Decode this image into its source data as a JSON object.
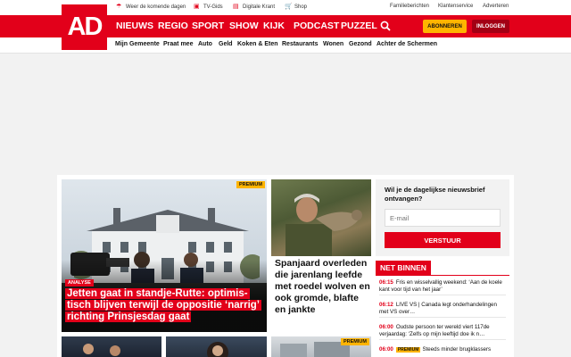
{
  "brand": {
    "logo_text": "AD",
    "accent": "#e2001a",
    "premium_color": "#ffb400"
  },
  "utility_left": [
    {
      "icon": "weather-icon",
      "label": "Weer de komende dagen"
    },
    {
      "icon": "tv-icon",
      "label": "TV-Gids"
    },
    {
      "icon": "newspaper-icon",
      "label": "Digitale Krant"
    },
    {
      "icon": "cart-icon",
      "label": "Shop"
    }
  ],
  "utility_right": [
    "Familieberichten",
    "Klantenservice",
    "Adverteren"
  ],
  "main_nav": [
    "NIEUWS",
    "REGIO",
    "SPORT",
    "SHOW",
    "KIJK",
    "PODCAST",
    "PUZZEL"
  ],
  "account": {
    "subscribe_label": "ABONNEREN",
    "login_label": "INLOGGEN"
  },
  "sub_nav": [
    "Mijn Gemeente",
    "Praat mee",
    "Auto",
    "Geld",
    "Koken & Eten",
    "Restaurants",
    "Wonen",
    "Gezond",
    "Achter de Schermen"
  ],
  "lead_article": {
    "badge": "PREMIUM",
    "tag": "ANALYSE",
    "headline": "Jetten gaat in standje-Rutte: optimis­tisch blijven terwijl de oppositie ‘narrig’ richting Prinsjesdag gaat"
  },
  "second_article": {
    "headline": "Spanjaard overleden die jarenlang leefde met roedel wolven en ook gromde, blafte en jankte"
  },
  "newsletter": {
    "question": "Wil je de dagelijkse nieuwsbrief ontvangen?",
    "email_placeholder": "E-mail",
    "submit_label": "VERSTUUR"
  },
  "net_binnen": {
    "title": "NET BINNEN",
    "items": [
      {
        "time": "06:15",
        "badge": "",
        "text": "Fris en wisselvallig weekend: ‘Aan de koele kant voor tijd van het jaar’"
      },
      {
        "time": "06:12",
        "badge": "",
        "text": "LIVE VS | Canada legt onderhandelingen met VS over…"
      },
      {
        "time": "06:00",
        "badge": "",
        "text": "Oudste persoon ter wereld viert 117de verjaardag: ‘Zelfs op mijn leeftijd doe ik n…"
      },
      {
        "time": "06:00",
        "badge": "PREMIUM",
        "text": "Steeds minder brugklassers"
      }
    ]
  },
  "bottom_row": {
    "premium_badge": "PREMIUM"
  }
}
